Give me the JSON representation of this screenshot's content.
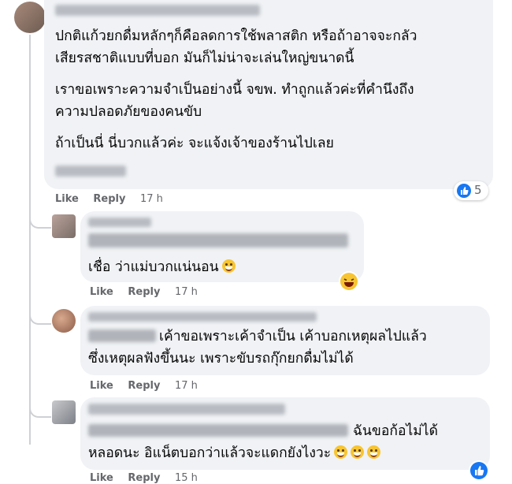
{
  "comment_main": {
    "lines": [
      "ปกติแก้วยกดื่มหลักๆก็คือลดการใช้พลาสติก หรือถ้าอาจจะกลัว",
      "เสียรสชาติแบบที่บอก มันก็ไม่น่าจะเล่นใหญ่ขนาดนี้",
      "เราขอเพราะความจำเป็นอย่างนี้ จขพ. ทำถูกแล้วค่ะที่คำนึงถึง",
      "ความปลอดภัยของคนขับ",
      "ถ้าเป็นนี่ นี่บวกแล้วค่ะ จะแจ้งเจ้าของร้านไปเลย"
    ],
    "like": "Like",
    "reply": "Reply",
    "time": "17 h",
    "reaction_count": "5",
    "reaction_icon": "like-reaction-icon",
    "reaction_color": "#1877f2"
  },
  "reply1": {
    "text": "เชื่อ ว่าแม่บวกแน่นอน",
    "emoji": "grinning-face-icon",
    "like": "Like",
    "reply": "Reply",
    "time": "17 h",
    "reaction_icon": "haha-reaction-icon"
  },
  "reply2": {
    "line1": "เค้าขอเพราะเค้าจำเป็น เค้าบอกเหตุผลไปแล้ว",
    "line2": "ซึ่งเหตุผลฟังขึ้นนะ เพราะขับรถกุ๊กยกดื่มไม่ได้",
    "like": "Like",
    "reply": "Reply",
    "time": "17 h"
  },
  "reply3": {
    "line1": "ฉันขอก้อไม่ได้",
    "line2": "หลอดนะ อิแน็ตบอกว่าแล้วจะแดกยังไงวะ",
    "emojis": "laughing-tears-icon x3",
    "like": "Like",
    "reply": "Reply",
    "time": "15 h",
    "reaction_icon": "like-reaction-icon"
  }
}
